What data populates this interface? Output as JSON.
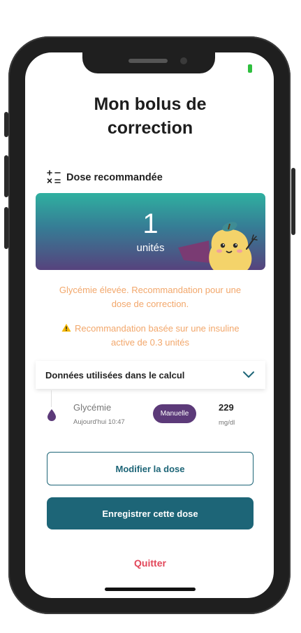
{
  "screen": {
    "title": "Mon bolus de correction",
    "dose_section_label": "Dose recommandée"
  },
  "dose": {
    "value": "1",
    "unit": "unités"
  },
  "messages": {
    "recommendation": "Glycémie élevée. Recommandation pour une dose de correction.",
    "warning": "Recommandation basée sur une insuline active de 0.3 unités"
  },
  "calc_data": {
    "panel_label": "Données utilisées dans le calcul",
    "glycemia": {
      "label": "Glycémie",
      "time": "Aujourd'hui 10:47",
      "source_badge": "Manuelle",
      "value": "229",
      "unit": "mg/dl"
    }
  },
  "actions": {
    "modify_label": "Modifier la dose",
    "save_label": "Enregistrer cette dose",
    "quit_label": "Quitter"
  },
  "colors": {
    "primary": "#1d6577",
    "accent_orange": "#f2a76b",
    "badge_purple": "#5c3a79",
    "quit_red": "#e2475a"
  }
}
